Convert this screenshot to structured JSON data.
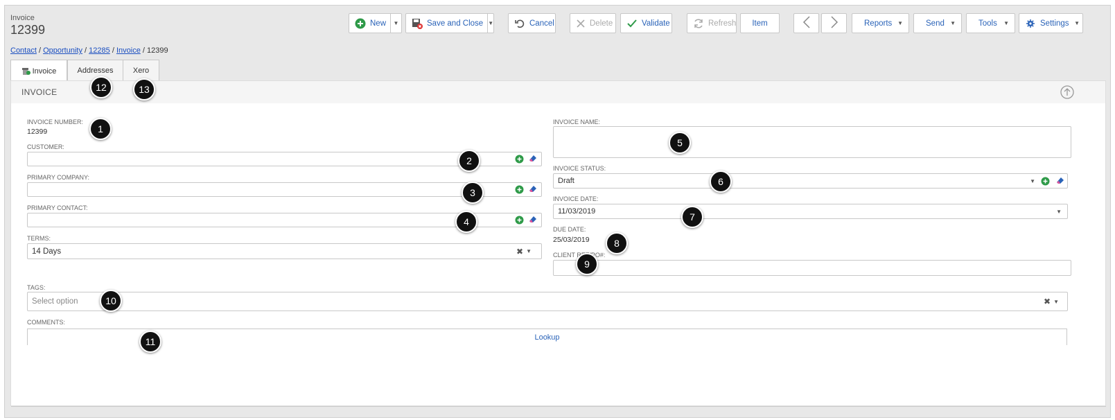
{
  "header": {
    "entity": "Invoice",
    "number": "12399"
  },
  "breadcrumb": [
    {
      "label": "Contact",
      "link": true
    },
    {
      "label": "Opportunity",
      "link": true
    },
    {
      "label": "12285",
      "link": true
    },
    {
      "label": "Invoice",
      "link": true
    },
    {
      "label": "12399",
      "link": false
    }
  ],
  "toolbar": {
    "new": "New",
    "save_close": "Save and Close",
    "cancel": "Cancel",
    "delete": "Delete",
    "validate": "Validate",
    "refresh": "Refresh",
    "item": "Item",
    "reports": "Reports",
    "send": "Send",
    "tools": "Tools",
    "settings": "Settings"
  },
  "tabs": [
    {
      "label": "Invoice"
    },
    {
      "label": "Addresses"
    },
    {
      "label": "Xero"
    }
  ],
  "section": {
    "title": "INVOICE"
  },
  "fields": {
    "invoice_number": {
      "label": "INVOICE NUMBER:",
      "value": "12399"
    },
    "customer": {
      "label": "CUSTOMER:",
      "value": ""
    },
    "primary_company": {
      "label": "PRIMARY COMPANY:",
      "value": ""
    },
    "primary_contact": {
      "label": "PRIMARY CONTACT:",
      "value": ""
    },
    "terms": {
      "label": "TERMS:",
      "value": "14 Days"
    },
    "invoice_name": {
      "label": "INVOICE NAME:",
      "value": ""
    },
    "invoice_status": {
      "label": "INVOICE STATUS:",
      "value": "Draft"
    },
    "invoice_date": {
      "label": "INVOICE DATE:",
      "value": "11/03/2019"
    },
    "due_date": {
      "label": "DUE DATE:",
      "value": "25/03/2019"
    },
    "client_ref": {
      "label": "CLIENT REF/PO#:",
      "value": ""
    },
    "tags": {
      "label": "TAGS:",
      "placeholder": "Select option"
    },
    "comments": {
      "label": "COMMENTS:",
      "lookup": "Lookup"
    }
  },
  "callouts": [
    "1",
    "2",
    "3",
    "4",
    "5",
    "6",
    "7",
    "8",
    "9",
    "10",
    "11",
    "12",
    "13"
  ],
  "colors": {
    "link": "#1a4ec0",
    "accent": "#2a63b8",
    "add_green": "#2e9a48",
    "eraser_pink": "#e0559a",
    "eraser_blue": "#2a63b8"
  }
}
